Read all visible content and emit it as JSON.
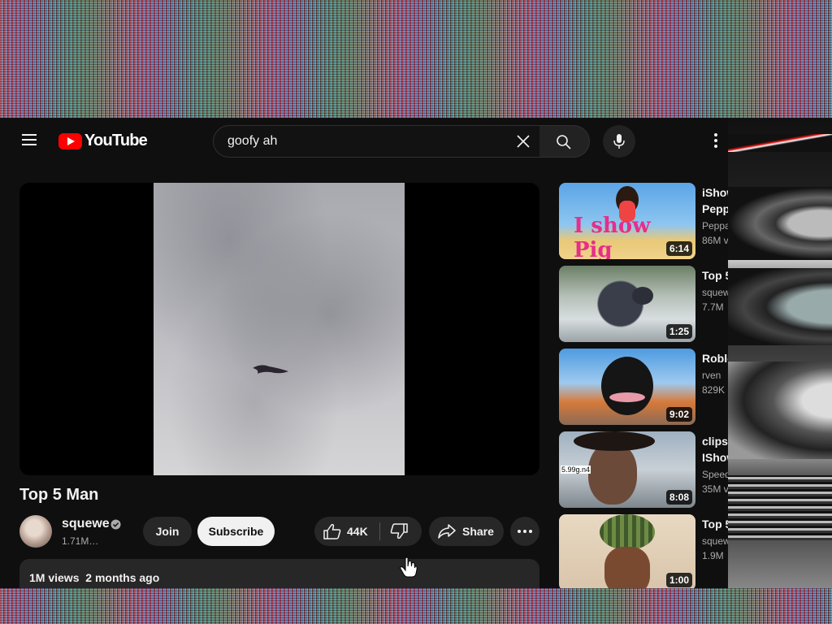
{
  "header": {
    "logo_text": "YouTube",
    "search_value": "goofy ah"
  },
  "video": {
    "title": "Top 5 Man",
    "channel": "squewe",
    "subscribers": "1.71M…",
    "join_label": "Join",
    "subscribe_label": "Subscribe",
    "likes": "44K",
    "share_label": "Share",
    "views": "1M views",
    "age": "2 months ago"
  },
  "recommendations": [
    {
      "title": "iShow Pepp",
      "line1": "Peppa",
      "line2": "86M v",
      "duration": "6:14",
      "thumb_text": "I show Pig"
    },
    {
      "title": "Top 5",
      "line1": "squew",
      "line2": "7.7M",
      "duration": "1:25"
    },
    {
      "title": "Roblo",
      "line1": "rven",
      "line2": "829K",
      "duration": "9:02"
    },
    {
      "title": "clips IShow",
      "line1": "Speed",
      "line2": "35M v",
      "duration": "8:08",
      "thumb_text": "5.99g.n4"
    },
    {
      "title": "Top 5",
      "line1": "squew",
      "line2": "1.9M",
      "duration": "1:00"
    }
  ],
  "colors": {
    "background": "#0f0f0f",
    "brand_red": "#ff0000",
    "pill": "#272727",
    "subscribe_bg": "#f1f1f1"
  }
}
